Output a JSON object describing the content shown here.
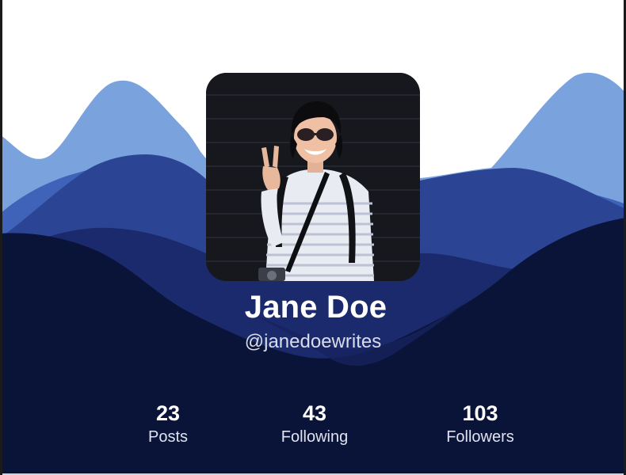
{
  "profile": {
    "name": "Jane Doe",
    "handle": "@janedoewrites",
    "avatar_icon": "profile-photo"
  },
  "stats": [
    {
      "value": "23",
      "label": "Posts"
    },
    {
      "value": "43",
      "label": "Following"
    },
    {
      "value": "103",
      "label": "Followers"
    }
  ],
  "colors": {
    "background": "#ffffff",
    "mountain_light": "#7aa3de",
    "mountain_mid": "#3f63b8",
    "mountain_dark": "#2b4594",
    "mountain_deep": "#1b2a6d",
    "foreground_navy": "#0a1338",
    "text_primary": "#ffffff"
  }
}
